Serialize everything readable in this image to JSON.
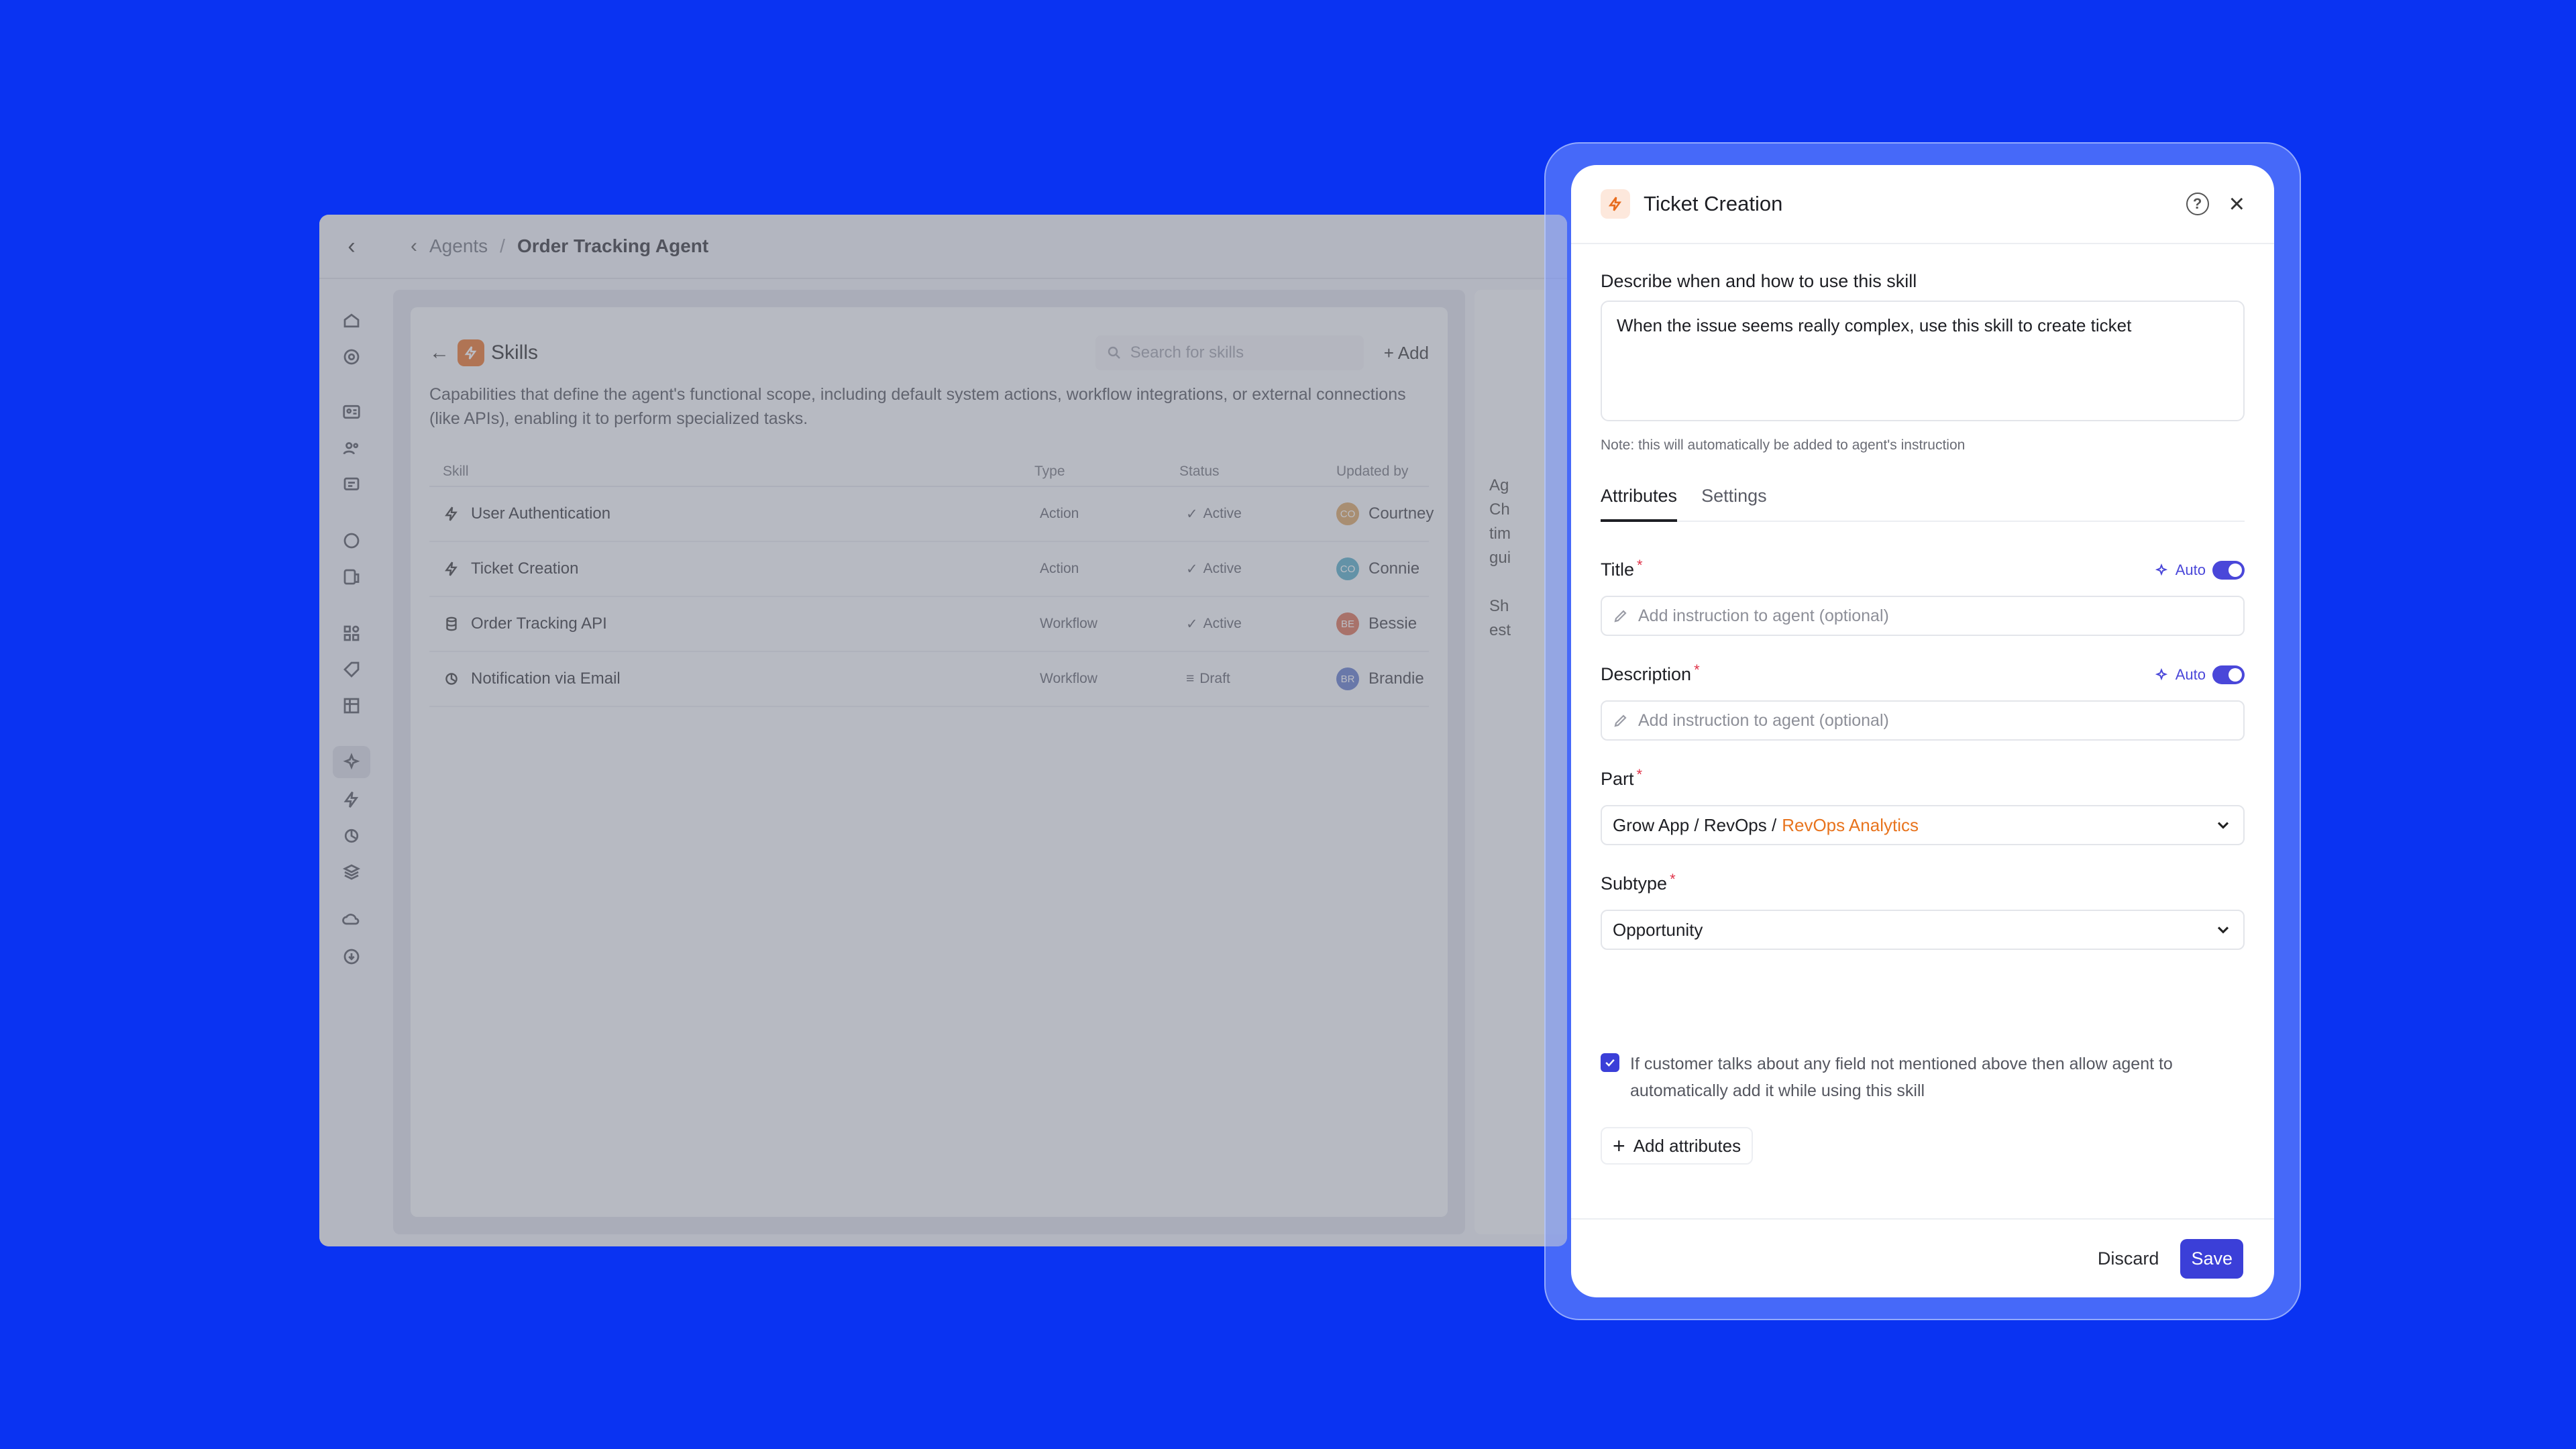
{
  "breadcrumb": {
    "parent": "Agents",
    "separator": "/",
    "current": "Order Tracking Agent"
  },
  "skills_card": {
    "title": "Skills",
    "search_placeholder": "Search for skills",
    "add_label": "Add",
    "description": "Capabilities that define the agent's functional scope, including default system actions, workflow integrations, or external connections (like APIs), enabling it to perform specialized tasks.",
    "columns": [
      "Skill",
      "Type",
      "Status",
      "Updated by"
    ],
    "rows": [
      {
        "skill": "User Authentication",
        "icon": "bolt-icon",
        "type": "Action",
        "status": "Active",
        "user": "Courtney",
        "initials": "CO",
        "avatar_color": "#d9a05b"
      },
      {
        "skill": "Ticket Creation",
        "icon": "bolt-icon",
        "type": "Action",
        "status": "Active",
        "user": "Connie",
        "initials": "CO",
        "avatar_color": "#4fa9c4"
      },
      {
        "skill": "Order Tracking API",
        "icon": "database-icon",
        "type": "Workflow",
        "status": "Active",
        "user": "Bessie",
        "initials": "BE",
        "avatar_color": "#d8694a"
      },
      {
        "skill": "Notification via Email",
        "icon": "workflow-icon",
        "type": "Workflow",
        "status": "Draft",
        "user": "Brandie",
        "initials": "BR",
        "avatar_color": "#5a74c9"
      }
    ]
  },
  "side_panel": {
    "lines": [
      "Ag",
      "Ch",
      "tim",
      "gui",
      "",
      "Sh",
      "est"
    ]
  },
  "modal": {
    "title": "Ticket Creation",
    "describe_label": "Describe when and how to use this skill",
    "describe_value": "When the issue seems really complex, use this skill to create ticket",
    "note": "Note: this will automatically be added to agent's instruction",
    "tabs": [
      "Attributes",
      "Settings"
    ],
    "fields": {
      "title": {
        "label": "Title",
        "required_mark": "*",
        "auto_label": "Auto",
        "placeholder": "Add instruction to agent (optional)"
      },
      "description": {
        "label": "Description",
        "required_mark": "*",
        "auto_label": "Auto",
        "placeholder": "Add instruction to agent (optional)"
      },
      "part": {
        "label": "Part",
        "required_mark": "*",
        "value_prefix": "Grow App / RevOps /",
        "value_highlight": "RevOps Analytics"
      },
      "subtype": {
        "label": "Subtype",
        "required_mark": "*",
        "value": "Opportunity"
      }
    },
    "checkbox_text": "If customer talks about any field not mentioned above then allow agent to automatically add it while using this skill",
    "add_attributes_label": "Add attributes",
    "discard_label": "Discard",
    "save_label": "Save"
  },
  "colors": {
    "background": "#0a33f2",
    "accent": "#3b3fd8",
    "orange": "#e8741e"
  }
}
